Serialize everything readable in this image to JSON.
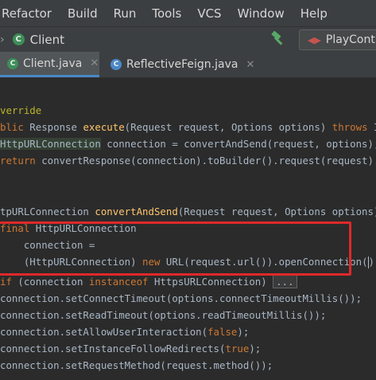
{
  "menu": [
    "Refactor",
    "Build",
    "Run",
    "Tools",
    "VCS",
    "Window",
    "Help"
  ],
  "nav": {
    "class_label": "Client",
    "run_config": "PlayContr"
  },
  "tabs": [
    {
      "label": "Client.java",
      "active": true
    },
    {
      "label": "ReflectiveFeign.java",
      "active": false
    }
  ],
  "code": {
    "l1_ann": "verride",
    "l2_a": "blic",
    "l2_b": " Response ",
    "l2_fn": "execute",
    "l2_c": "(Request request, Options options) ",
    "l2_kw": "throws",
    "l2_d": " IOEx",
    "l3_a": "HttpURLConnection",
    "l3_b": " connection = convertAndSend(request, options);",
    "l4_kw": "return",
    "l4_b": " convertResponse(connection).toBuilder().request(request).bui",
    "l5_a": "tpURLConnection ",
    "l5_fn": "convertAndSend",
    "l5_b": "(Request request, Options options) th",
    "l6_kw": "final",
    "l6_b": " HttpURLConnection",
    "l7": "    connection =",
    "l8_a": "    (HttpURLConnection) ",
    "l8_kw": "new",
    "l8_b": " URL(request.url()).openConnection(",
    "l8_c": ");",
    "l9_kw": "if",
    "l9_b": " (connection ",
    "l9_kw2": "instanceof",
    "l9_c": " HttpsURLConnection) ",
    "l9_fold": "...",
    "l10": "connection.setConnectTimeout(options.connectTimeoutMillis());",
    "l11": "connection.setReadTimeout(options.readTimeoutMillis());",
    "l12_a": "connection.setAllowUserInteraction(",
    "l12_kw": "false",
    "l12_b": ");",
    "l13_a": "connection.setInstanceFollowRedirects(",
    "l13_kw": "true",
    "l13_b": ");",
    "l14": "connection.setRequestMethod(request.method());"
  }
}
